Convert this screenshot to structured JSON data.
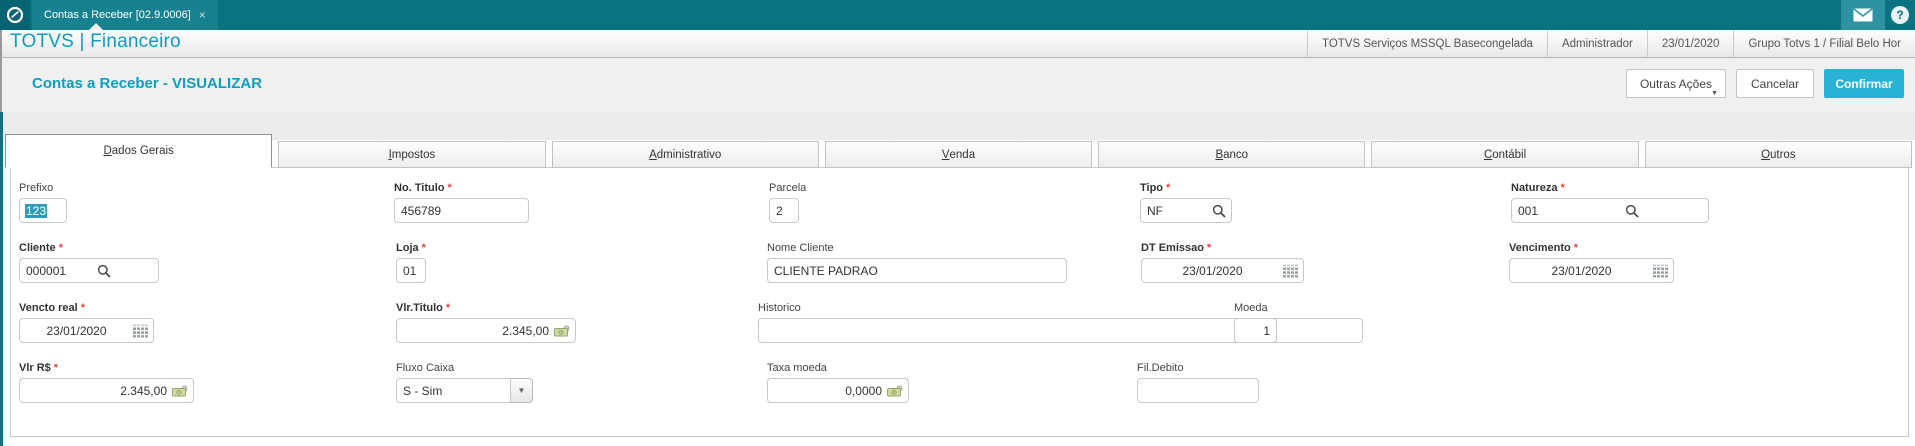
{
  "topbar": {
    "tab_label": "Contas a Receber [02.9.0006]",
    "tab_close": "×",
    "help_glyph": "?"
  },
  "header": {
    "brand": "TOTVS | Financeiro",
    "context": [
      "TOTVS Serviços MSSQL Basecongelada",
      "Administrador",
      "23/01/2020",
      "Grupo Totvs 1 / Filial Belo Hor"
    ]
  },
  "toolbar": {
    "title": "Contas a Receber - VISUALIZAR",
    "other_actions": "Outras Ações",
    "other_actions_caret": "▼",
    "cancel": "Cancelar",
    "confirm": "Confirmar"
  },
  "tabs": [
    {
      "label": "Dados Gerais",
      "active": true
    },
    {
      "label": "Impostos",
      "active": false
    },
    {
      "label": "Administrativo",
      "active": false
    },
    {
      "label": "Venda",
      "active": false
    },
    {
      "label": "Banco",
      "active": false
    },
    {
      "label": "Contábil",
      "active": false
    },
    {
      "label": "Outros",
      "active": false
    }
  ],
  "required_marker": "*",
  "select_arrow_glyph": "▼",
  "form": {
    "prefixo": {
      "label": "Prefixo",
      "value": "123"
    },
    "no_titulo": {
      "label": "No. Titulo",
      "value": "456789"
    },
    "parcela": {
      "label": "Parcela",
      "value": "2"
    },
    "tipo": {
      "label": "Tipo",
      "value": "NF"
    },
    "natureza": {
      "label": "Natureza",
      "value": "001"
    },
    "cliente": {
      "label": "Cliente",
      "value": "000001"
    },
    "loja": {
      "label": "Loja",
      "value": "01"
    },
    "nome_cliente": {
      "label": "Nome Cliente",
      "value": "CLIENTE PADRAO"
    },
    "dt_emissao": {
      "label": "DT Emissao",
      "value": "23/01/2020"
    },
    "vencimento": {
      "label": "Vencimento",
      "value": "23/01/2020"
    },
    "vencto_real": {
      "label": "Vencto real",
      "value": "23/01/2020"
    },
    "vlr_titulo": {
      "label": "Vlr.Titulo",
      "value": "2.345,00"
    },
    "historico": {
      "label": "Historico",
      "value": ""
    },
    "moeda": {
      "label": "Moeda",
      "value": "1"
    },
    "vlr_rs": {
      "label": "Vlr R$",
      "value": "2.345,00"
    },
    "fluxo_caixa": {
      "label": "Fluxo Caixa",
      "value": "S - Sim"
    },
    "taxa_moeda": {
      "label": "Taxa moeda",
      "value": "0,0000"
    },
    "fil_debito": {
      "label": "Fil.Debito",
      "value": ""
    }
  },
  "colors": {
    "topbar": "#0a7280",
    "brand_blue": "#0c9dc0",
    "confirm_button": "#29b2d3",
    "required": "#e04545",
    "selection": "#2e9db8"
  }
}
